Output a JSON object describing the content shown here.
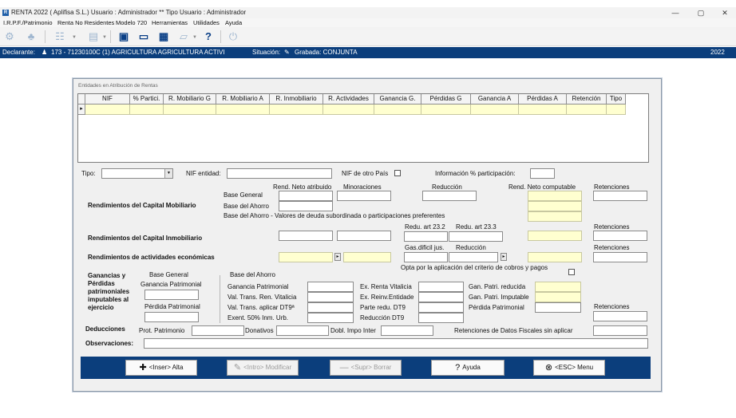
{
  "window": {
    "title": "RENTA 2022  ( Aplifisa S.L.) Usuario : Administrador  **  Tipo Usuario : Administrador",
    "app_icon_letter": "R",
    "minimize": "—",
    "maximize": "▢",
    "close": "✕"
  },
  "menu": [
    "I.R.P.F./Patrimonio",
    "Renta No Residentes",
    "Modelo 720",
    "Herramientas",
    "Utilidades",
    "Ayuda"
  ],
  "declarant_bar": {
    "label": "Declarante:",
    "value": "173 - 71230100C  (1)  AGRICULTURA AGRICULTURA ACTIVI",
    "situacion": "Situación:",
    "estado": "Grabada: CONJUNTA",
    "year": "2022"
  },
  "dialog": {
    "group_title": "Entidades en Atribución de Rentas",
    "grid_columns": [
      "NIF",
      "% Partici.",
      "R. Mobiliario G",
      "R. Mobiliario A",
      "R. Inmobiliario",
      "R. Actividades",
      "Ganancia G.",
      "Pérdidas G",
      "Ganancia A",
      "Pérdidas A",
      "Retención",
      "Tipo"
    ],
    "row_marker": "▸",
    "tipo_label": "Tipo:",
    "nif_entidad_label": "NIF entidad:",
    "nif_otro_pais_label": "NIF de otro País",
    "info_participacion_label": "Información % participación:",
    "rcm": {
      "title": "Rendimientos del Capital Mobiliario",
      "rend_neto_atribuido": "Rend. Neto atribuido",
      "minoraciones": "Minoraciones",
      "reduccion": "Reducción",
      "rend_neto_computable": "Rend. Neto computable",
      "retenciones": "Retenciones",
      "base_general": "Base General",
      "base_ahorro": "Base del Ahorro",
      "base_ahorro_deuda": "Base del Ahorro - Valores de deuda subordinada o participaciones preferentes"
    },
    "rci": {
      "title": "Rendimientos del Capital Inmobiliario",
      "redu_23_2": "Redu. art 23.2",
      "redu_23_3": "Redu. art 23.3",
      "retenciones": "Retenciones"
    },
    "rae": {
      "title": "Rendimientos de actividades económicas",
      "gas_dificil": "Gas.dificil jus.",
      "reduccion": "Reducción",
      "retenciones": "Retenciones",
      "opta_criterio": "Opta por la aplicación del criterio de cobros y pagos"
    },
    "gp": {
      "title": "Ganancias  y Pérdidas patrimoniales imputables al ejercicio",
      "base_general": "Base General",
      "ganancia_patrimonial": "Ganancia Patrimonial",
      "perdida_patrimonial": "Pérdida Patrimonial",
      "base_ahorro": "Base del Ahorro",
      "gp_ganancia": "Ganancia Patrimonial",
      "val_trans_ren_vitalicia": "Val. Trans. Ren. Vitalicia",
      "val_trans_aplicar_dt9": "Val. Trans. aplicar  DT9ª",
      "exent_50": "Exent. 50% Inm. Urb.",
      "ex_renta_vitalicia": "Ex. Renta Vitalicia",
      "ex_reinv_entidade": "Ex. Reinv.Entidade",
      "parte_redu_dt9": "Parte redu. DT9",
      "reduccion_dt9": "Reducción DT9",
      "gan_patri_reducida": "Gan. Patri. reducida",
      "gan_patri_imputable": "Gan. Patri. Imputable",
      "perdida_patrimonial_ahorro": "Pérdida Patrimonial",
      "retenciones": "Retenciones"
    },
    "deducciones": {
      "title": "Deducciones",
      "prot_patrimonio": "Prot. Patrimonio",
      "donativos": "Donativos",
      "dobl_impo_inter": "Dobl. Impo Inter",
      "retenciones_datos_fiscales": "Retenciones de Datos Fiscales sin aplicar"
    },
    "observaciones_label": "Observaciones:",
    "buttons": {
      "alta": "<Inser> Alta",
      "modificar": "<Intro> Modificar",
      "borrar": "<Supr> Borrar",
      "ayuda": "Ayuda",
      "menu": "<ESC> Menu"
    }
  }
}
